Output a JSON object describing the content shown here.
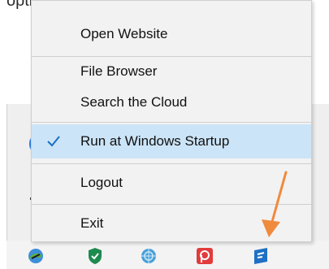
{
  "background_text": "options,",
  "menu": {
    "items": [
      {
        "label": "Open Website",
        "checked": false
      },
      {
        "label": "File Browser",
        "checked": false
      },
      {
        "label": "Search the Cloud",
        "checked": false
      },
      {
        "label": "Run at Windows Startup",
        "checked": true
      },
      {
        "label": "Logout",
        "checked": false
      },
      {
        "label": "Exit",
        "checked": false
      }
    ]
  },
  "tray": {
    "icons": [
      {
        "name": "snipping-tool-icon"
      },
      {
        "name": "security-shield-icon",
        "color": "#1d8a4e"
      },
      {
        "name": "network-globe-icon",
        "color": "#49a0d8"
      },
      {
        "name": "pocket-app-icon",
        "color": "#e23b3b"
      },
      {
        "name": "cloud-drive-app-icon",
        "color": "#1f6fc5"
      }
    ]
  },
  "colors": {
    "menu_bg": "#f2f2f2",
    "checked_highlight": "#cce4f7",
    "check_mark": "#1a6fc4",
    "arrow": "#f08a3c"
  }
}
